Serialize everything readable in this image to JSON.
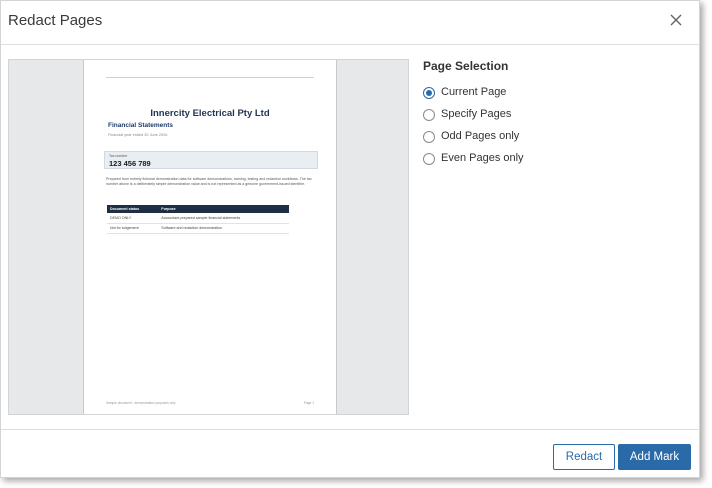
{
  "dialog": {
    "title": "Redact Pages",
    "close_icon": "close-icon"
  },
  "preview": {
    "company": "Innercity Electrical Pty Ltd",
    "doc_title": "Financial Statements",
    "doc_subtitle": "Financial year ended 30 June 2026",
    "tax_label": "Tax number",
    "tax_number": "123 456 789",
    "paragraph": "Prepared from entirely fictional demonstration data for software demonstrations, training, testing and redaction workflows. The tax number above is a deliberately simple demonstration value and is not represented as a genuine government-issued identifier.",
    "table": {
      "headers": [
        "Document status",
        "Purpose"
      ],
      "rows": [
        [
          "DEMO ONLY",
          "Accountant-prepared sample financial statements"
        ],
        [
          "Not for lodgement",
          "Software and redaction demonstration"
        ]
      ]
    },
    "footer_left": "Sample document - demonstration purposes only",
    "footer_right": "Page 1"
  },
  "selection": {
    "title": "Page Selection",
    "options": [
      {
        "label": "Current Page",
        "checked": true
      },
      {
        "label": "Specify Pages",
        "checked": false
      },
      {
        "label": "Odd Pages only",
        "checked": false
      },
      {
        "label": "Even Pages only",
        "checked": false
      }
    ]
  },
  "buttons": {
    "redact": "Redact",
    "add_mark": "Add Mark"
  },
  "colors": {
    "accent": "#2b6aa8",
    "table_header": "#1e2f45"
  }
}
